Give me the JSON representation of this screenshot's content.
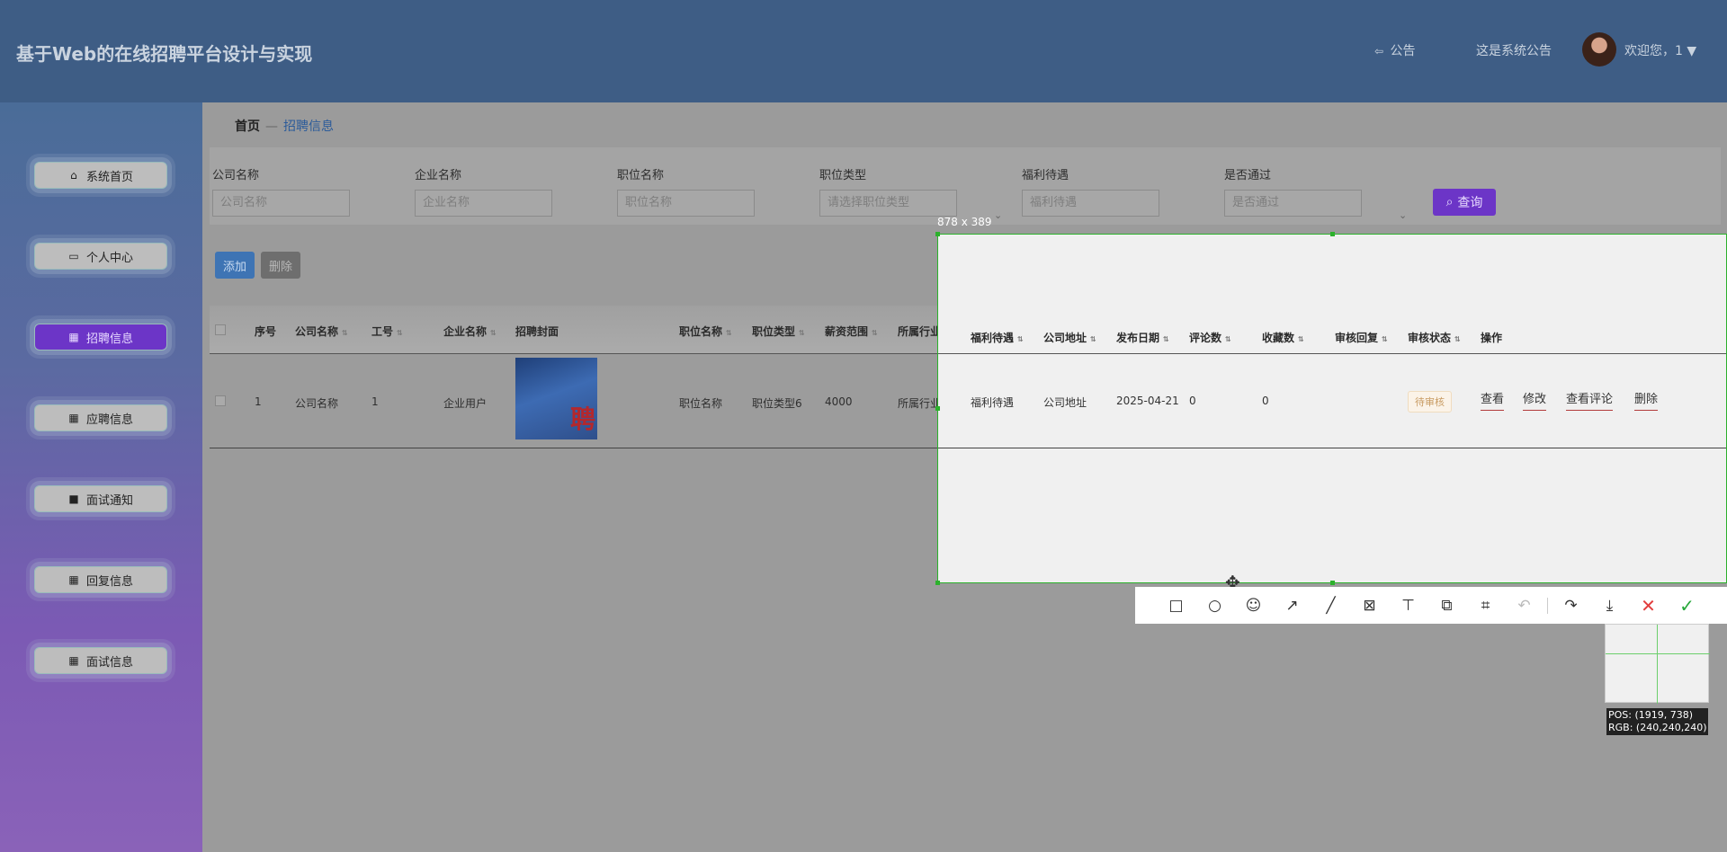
{
  "header": {
    "app_title": "基于Web的在线招聘平台设计与实现",
    "notice_icon": "⇦",
    "notice_label": "公告",
    "system_notice": "这是系统公告",
    "welcome": "欢迎您，1 ▼"
  },
  "sidebar": {
    "items": [
      {
        "label": "系统首页",
        "icon": "home-icon"
      },
      {
        "label": "个人中心",
        "icon": "card-icon"
      },
      {
        "label": "招聘信息",
        "icon": "grid-icon",
        "active": true
      },
      {
        "label": "应聘信息",
        "icon": "grid-icon"
      },
      {
        "label": "面试通知",
        "icon": "briefcase-icon"
      },
      {
        "label": "回复信息",
        "icon": "grid-icon"
      },
      {
        "label": "面试信息",
        "icon": "grid-icon"
      }
    ]
  },
  "breadcrumb": {
    "home": "首页",
    "sep": "—",
    "current": "招聘信息"
  },
  "search": {
    "fields": [
      {
        "label": "公司名称",
        "placeholder": "公司名称"
      },
      {
        "label": "企业名称",
        "placeholder": "企业名称"
      },
      {
        "label": "职位名称",
        "placeholder": "职位名称"
      },
      {
        "label": "职位类型",
        "placeholder": "请选择职位类型"
      },
      {
        "label": "福利待遇",
        "placeholder": "福利待遇"
      },
      {
        "label": "是否通过",
        "placeholder": "是否通过"
      }
    ],
    "button": "查询"
  },
  "actions": {
    "add": "添加",
    "delete": "删除"
  },
  "table": {
    "headers": [
      "序号",
      "公司名称",
      "工号",
      "企业名称",
      "招聘封面",
      "职位名称",
      "职位类型",
      "薪资范围",
      "所属行业",
      "福利待遇",
      "公司地址",
      "发布日期",
      "评论数",
      "收藏数",
      "审核回复",
      "审核状态",
      "操作"
    ],
    "rows": [
      {
        "index": "1",
        "company": "公司名称",
        "job_no": "1",
        "enterprise": "企业用户",
        "cover_text": "聘",
        "position": "职位名称",
        "position_type": "职位类型6",
        "salary": "4000",
        "industry": "所属行业",
        "welfare": "福利待遇",
        "address": "公司地址",
        "date": "2025-04-21",
        "comments": "0",
        "favorites": "0",
        "review_reply": "",
        "status": "待审核",
        "ops": [
          "查看",
          "修改",
          "查看评论",
          "删除"
        ]
      }
    ]
  },
  "capture_overlay": {
    "size_label": "878 x 389",
    "pos_label": "POS:  (1919, 738)",
    "rgb_label": "RGB:  (240,240,240)",
    "tools": [
      "rectangle-icon",
      "ellipse-icon",
      "emoji-icon",
      "arrow-icon",
      "line-icon",
      "mosaic-icon",
      "text-icon",
      "copy-icon",
      "ocr-icon",
      "undo-icon",
      "share-icon",
      "save-icon",
      "cancel-icon",
      "confirm-icon"
    ]
  }
}
